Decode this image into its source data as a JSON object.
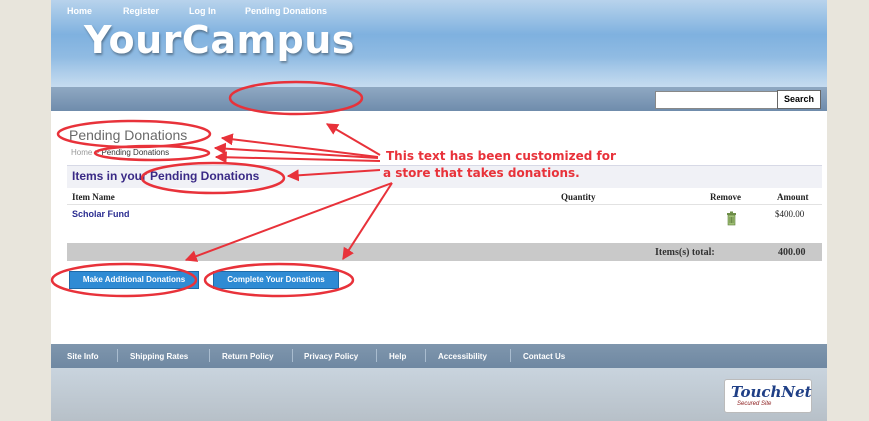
{
  "brand": {
    "logo_text": "YourCampus",
    "accent_color": "#2f8bd4",
    "annotation_color": "#e8323a"
  },
  "nav": {
    "items": [
      "Home",
      "Register",
      "Log In",
      "Pending Donations"
    ]
  },
  "search": {
    "placeholder": "",
    "button_label": "Search"
  },
  "page": {
    "title": "Pending Donations"
  },
  "breadcrumb": {
    "home": "Home",
    "current": "Pending Donations"
  },
  "cart": {
    "heading": "Items in your Pending Donations",
    "columns": {
      "item_name": "Item Name",
      "quantity": "Quantity",
      "remove": "Remove",
      "amount": "Amount"
    },
    "rows": [
      {
        "name": "Scholar Fund",
        "quantity": "",
        "amount": "$400.00"
      }
    ],
    "remove_icon": "trash-icon",
    "total_label": "Items(s) total:",
    "total_value": "400.00"
  },
  "actions": {
    "additional": "Make Additional Donations",
    "complete": "Complete Your Donations"
  },
  "footer": {
    "items": [
      "Site Info",
      "Shipping Rates",
      "Return Policy",
      "Privacy Policy",
      "Help",
      "Accessibility",
      "Contact Us"
    ]
  },
  "touchnet": {
    "name": "TouchNet",
    "tagline": "Secured Site"
  },
  "annotation": {
    "line1": "This text has been customized for",
    "line2": "a store that takes donations."
  }
}
